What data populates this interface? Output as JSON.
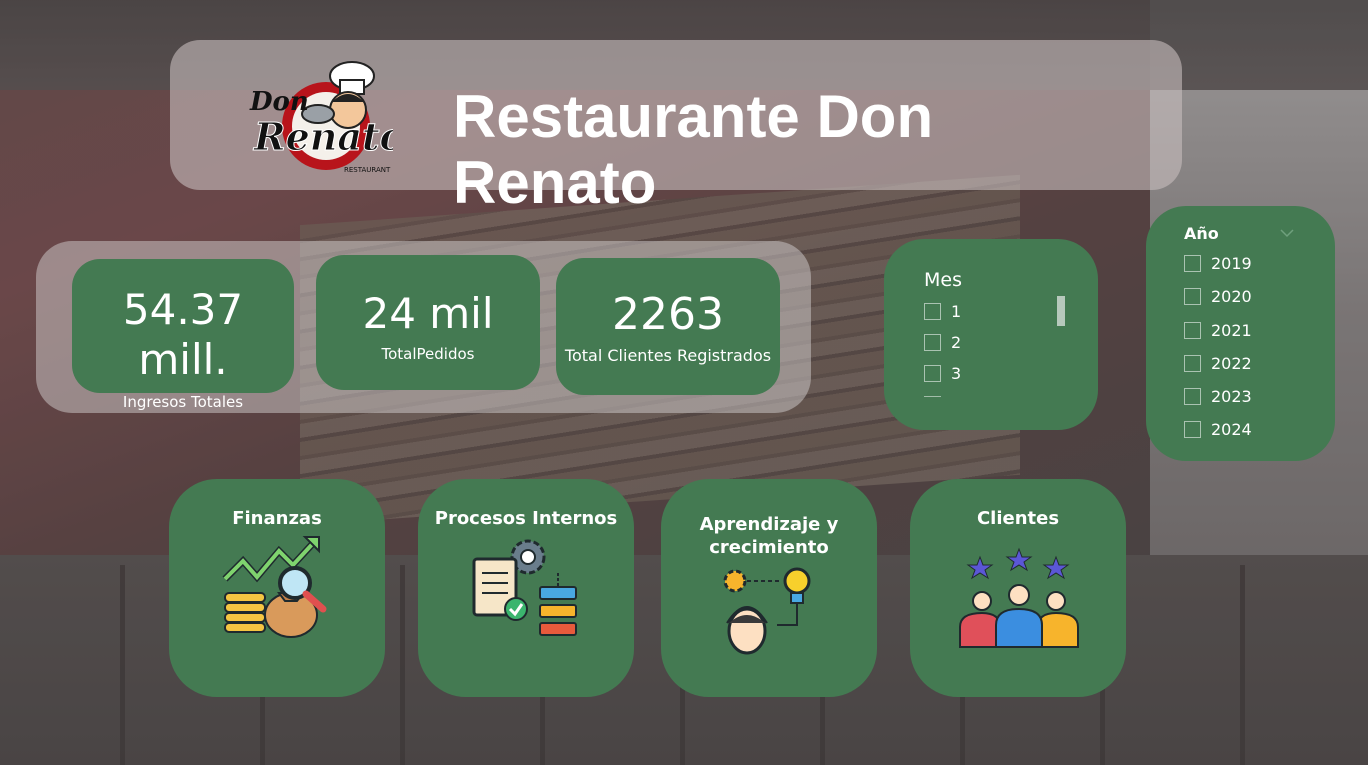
{
  "header": {
    "title": "Restaurante Don Renato",
    "logo_text_top": "Don",
    "logo_text_main": "Renato",
    "logo_text_sub": "RESTAURANT"
  },
  "kpis": [
    {
      "value": "54.37 mill.",
      "label": "Ingresos Totales"
    },
    {
      "value": "24 mil",
      "label": "TotalPedidos"
    },
    {
      "value": "2263",
      "label": "Total Clientes Registrados"
    }
  ],
  "mes_slicer": {
    "title": "Mes",
    "options": [
      "1",
      "2",
      "3"
    ]
  },
  "anio_slicer": {
    "title": "Año",
    "options": [
      "2019",
      "2020",
      "2021",
      "2022",
      "2023",
      "2024"
    ]
  },
  "nav": [
    {
      "label": "Finanzas",
      "icon": "finance-icon"
    },
    {
      "label": "Procesos Internos",
      "icon": "process-icon"
    },
    {
      "label": "Aprendizaje y crecimiento",
      "icon": "learning-icon"
    },
    {
      "label": "Clientes",
      "icon": "clients-icon"
    }
  ],
  "colors": {
    "card": "#447a52",
    "accent": "#ffffff"
  }
}
